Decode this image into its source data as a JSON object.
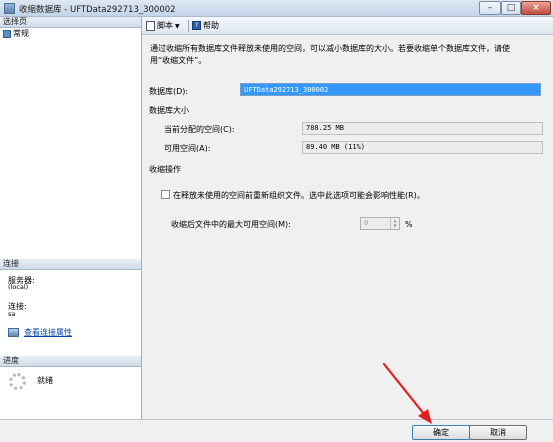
{
  "window": {
    "title": "收缩数据库 - UFTData292713_300002"
  },
  "sidebar": {
    "select_page_header": "选择页",
    "pages": [
      {
        "label": "常规"
      }
    ],
    "connection_header": "连接",
    "server_label": "服务器:",
    "server_value": "(local)",
    "connection_label": "连接:",
    "connection_value": "sa",
    "view_properties_link": "查看连接属性",
    "progress_header": "进度",
    "progress_status": "就绪"
  },
  "toolbar": {
    "script_label": "脚本",
    "help_label": "帮助"
  },
  "main": {
    "description": "通过收缩所有数据库文件释放未使用的空间，可以减小数据库的大小。若要收缩单个数据库文件，请使用“收缩文件”。",
    "database_label": "数据库(D):",
    "database_value": "UFTData292713_300002",
    "size_heading": "数据库大小",
    "allocated_label": "当前分配的空间(C):",
    "allocated_value": "788.25 MB",
    "free_label": "可用空间(A):",
    "free_value": "89.40 MB (11%)",
    "shrink_heading": "收缩操作",
    "reorganize_label": "在释放未使用的空间前重新组织文件。选中此选项可能会影响性能(R)。",
    "reorganize_checked": false,
    "max_free_label": "收缩后文件中的最大可用空间(M):",
    "max_free_value": "0",
    "percent_label": "%"
  },
  "buttons": {
    "ok_label": "确定",
    "cancel_label": "取消"
  },
  "colors": {
    "selection": "#3399ff",
    "annotation_arrow": "#e02020",
    "link": "#0645ad"
  }
}
